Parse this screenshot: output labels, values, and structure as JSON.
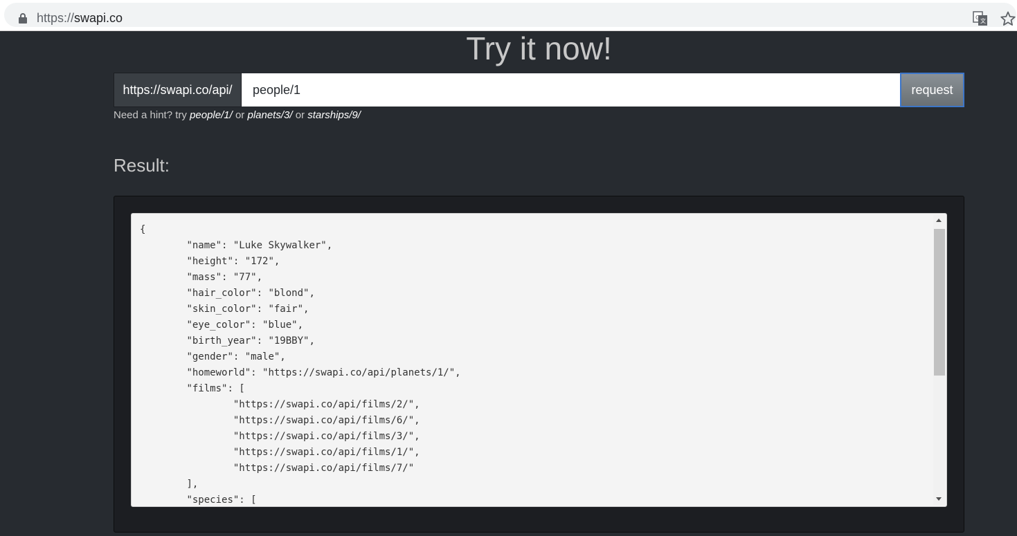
{
  "browser": {
    "url_scheme": "https://",
    "url_host": "swapi.co",
    "icons": [
      "lock-icon",
      "translate-icon",
      "star-icon"
    ]
  },
  "page": {
    "title": "Try it now!",
    "api_prefix": "https://swapi.co/api/",
    "input_value": "people/1",
    "request_label": "request",
    "hint": {
      "prefix": "Need a hint? try ",
      "link1": "people/1/",
      "or1": " or ",
      "link2": "planets/3/",
      "or2": " or ",
      "link3": "starships/9/"
    },
    "result_heading": "Result:",
    "result_text": "{\n\t\"name\": \"Luke Skywalker\",\n\t\"height\": \"172\",\n\t\"mass\": \"77\",\n\t\"hair_color\": \"blond\",\n\t\"skin_color\": \"fair\",\n\t\"eye_color\": \"blue\",\n\t\"birth_year\": \"19BBY\",\n\t\"gender\": \"male\",\n\t\"homeworld\": \"https://swapi.co/api/planets/1/\",\n\t\"films\": [\n\t\t\"https://swapi.co/api/films/2/\",\n\t\t\"https://swapi.co/api/films/6/\",\n\t\t\"https://swapi.co/api/films/3/\",\n\t\t\"https://swapi.co/api/films/1/\",\n\t\t\"https://swapi.co/api/films/7/\"\n\t],\n\t\"species\": ["
  },
  "colors": {
    "background": "#272b30",
    "well": "#1c1e22",
    "button_border": "#3d76c9"
  }
}
